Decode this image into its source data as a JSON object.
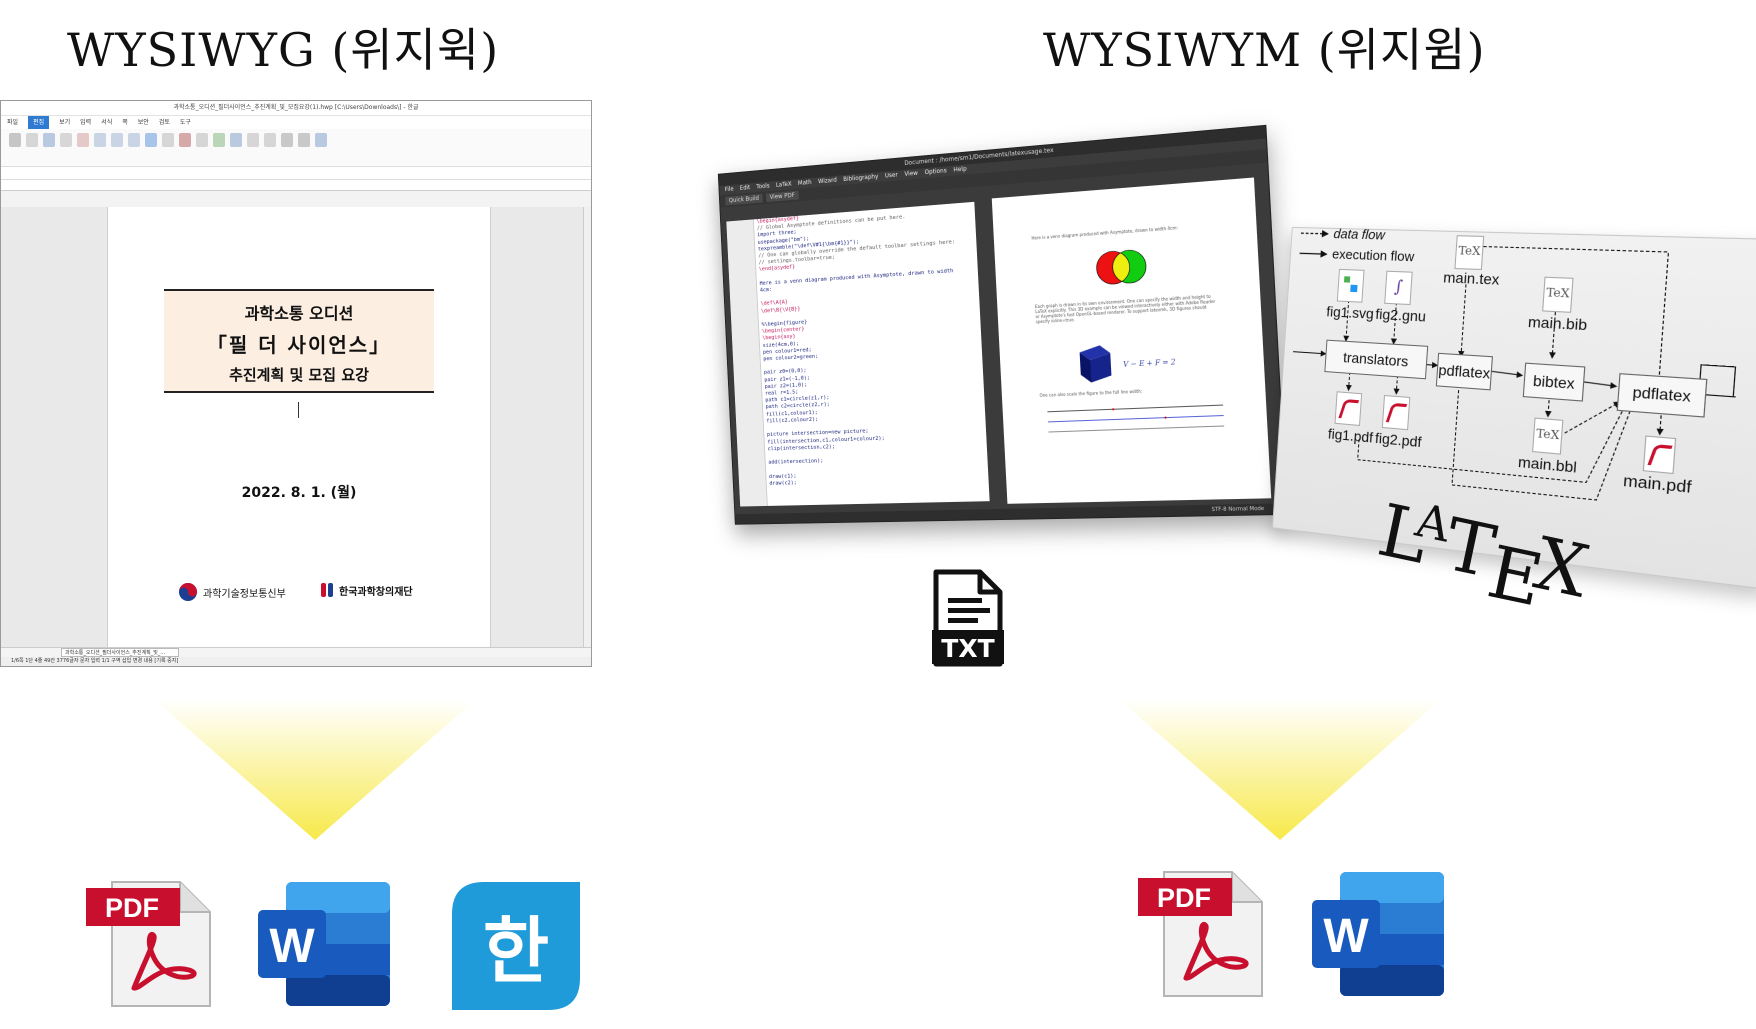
{
  "headings": {
    "wysiwyg": "WYSIWYG (위지윅)",
    "wysiwym": "WYSIWYM (위지윔)"
  },
  "hwp_window": {
    "title": "과학소통_오디션_필더사이언스_추진계획_및_모집요강(1).hwp [C:\\Users\\Downloads\\] - 한글",
    "menus": [
      "파일",
      "편집",
      "보기",
      "입력",
      "서식",
      "쪽",
      "보안",
      "검토",
      "도구"
    ],
    "doc": {
      "line1": "과학소통 오디션",
      "line2": "「필 더 사이언스」",
      "line3": "추진계획 및 모집 요강",
      "date": "2022. 8. 1. (월)",
      "org1": "과학기술정보통신부",
      "org2": "한국과학창의재단"
    },
    "tab_label": "과학소통_오디션_필더사이언스_추진계획_및_...",
    "status": "1/6쪽   1단   4줄   49칸   3776글자   문자 입력   1/1 구역   삽입   변경 내용 [기록 중지]"
  },
  "kile_window": {
    "title": "Document : /home/sm1/Documents/latexusage.tex",
    "menus": [
      "File",
      "Edit",
      "Tools",
      "LaTeX",
      "Math",
      "Wizard",
      "Bibliography",
      "User",
      "View",
      "Options",
      "Help"
    ],
    "toolbar": [
      "Quick Build",
      "View PDF"
    ],
    "code_lines": [
      "\\begin{asydef}",
      "// Global Asymptote definitions can be put here.",
      "import three;",
      "usepackage(\"bm\");",
      "texpreamble(\"\\def\\V#1{\\bm{#1}}\");",
      "// One can globally override the default toolbar settings here:",
      "// settings.toolbar=true;",
      "\\end{asydef}",
      "",
      "Here is a venn diagram produced with Asymptote, drawn to width",
      "4cm:",
      "",
      "\\def\\A{A}",
      "\\def\\B{\\V{B}}",
      "",
      "%\\begin{figure}",
      "\\begin{center}",
      "\\begin{asy}",
      "size(4cm,0);",
      "pen colour1=red;",
      "pen colour2=green;",
      "",
      "pair z0=(0,0);",
      "pair z1=(-1,0);",
      "pair z2=(1,0);",
      "real r=1.5;",
      "path c1=circle(z1,r);",
      "path c2=circle(z2,r);",
      "fill(c1,colour1);",
      "fill(c2,colour2);",
      "",
      "picture intersection=new picture;",
      "fill(intersection,c1,colour1+colour2);",
      "clip(intersection,c2);",
      "",
      "add(intersection);",
      "",
      "draw(c1);",
      "draw(c2);"
    ],
    "preview_text1": "Here is a venn diagram produced with Asymptote, drawn to width 4cm:",
    "preview_text2": "Each graph is drawn in its own environment. One can specify the width and height to LaTeX explicitly. This 3D example can be viewed interactively either with Adobe Reader or Asymptote's fast OpenGL-based renderer. To support latexmk, 3D figures should specify inline=true.",
    "preview_text3": "One can also scale the figure to the full line width:",
    "formula": "V − E + F = 2",
    "status": "STF-8   Normal Mode"
  },
  "latex_flow": {
    "legend": [
      "data flow",
      "execution flow"
    ],
    "files": [
      "main.tex",
      "fig1.svg",
      "fig2.gnu",
      "main.bib",
      "fig1.pdf",
      "fig2.pdf",
      "main.bbl",
      "main.pdf"
    ],
    "steps": [
      "translators",
      "pdflatex",
      "bibtex",
      "pdflatex"
    ],
    "logo": "LATEX"
  },
  "icons": {
    "txt_label": "TXT",
    "pdf_label": "PDF",
    "word_label": "W",
    "hangul_label": "한"
  },
  "colors": {
    "arrow_yellow": "#f7e94a",
    "pdf_red": "#c8102e",
    "word_blue": "#2b579a",
    "hangul_blue": "#1f9bd9"
  }
}
